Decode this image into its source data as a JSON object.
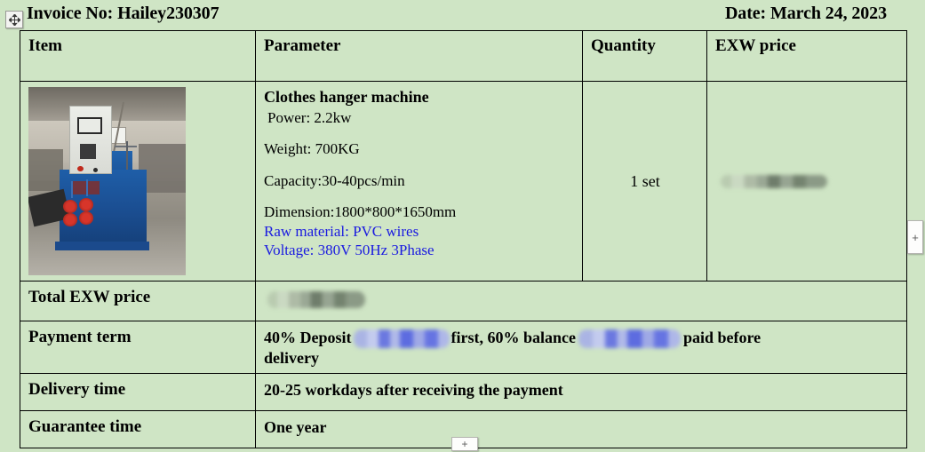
{
  "document": {
    "invoice_no_label": "Invoice No: Hailey230307",
    "date_label": "Date: March 24, 2023"
  },
  "table": {
    "headers": {
      "item": "Item",
      "parameter": "Parameter",
      "quantity": "Quantity",
      "exw_price": "EXW price"
    },
    "product_row": {
      "photo_alt": "clothes-hanger-machine-photo",
      "title": "Clothes hanger machine",
      "specs": [
        "Power: 2.2kw",
        "Weight: 700KG",
        "Capacity:30-40pcs/min",
        "Dimension:1800*800*1650mm"
      ],
      "blue_specs": [
        "Raw material: PVC wires",
        "Voltage: 380V 50Hz 3Phase"
      ],
      "quantity": "1 set",
      "exw_price": ""
    },
    "rows": [
      {
        "label": "Total EXW price",
        "value": ""
      },
      {
        "label": "Payment term",
        "value": ""
      },
      {
        "label": "Delivery time",
        "value": "20-25 workdays after receiving the payment"
      },
      {
        "label": "Guarantee time",
        "value": "One year"
      }
    ],
    "payment_term": {
      "part1": "40% Deposit",
      "part2": "first, 60% balance",
      "part3": "paid before",
      "part4": "delivery"
    }
  },
  "controls": {
    "move_handle": "table-move-handle",
    "add_column": "+",
    "add_row": "+"
  },
  "colors": {
    "page_background": "#cfe5c5",
    "border": "#000000",
    "blue_text": "#1a1ae0",
    "redaction_grey": "#8b9a86",
    "redaction_blue": "#6674e2"
  }
}
